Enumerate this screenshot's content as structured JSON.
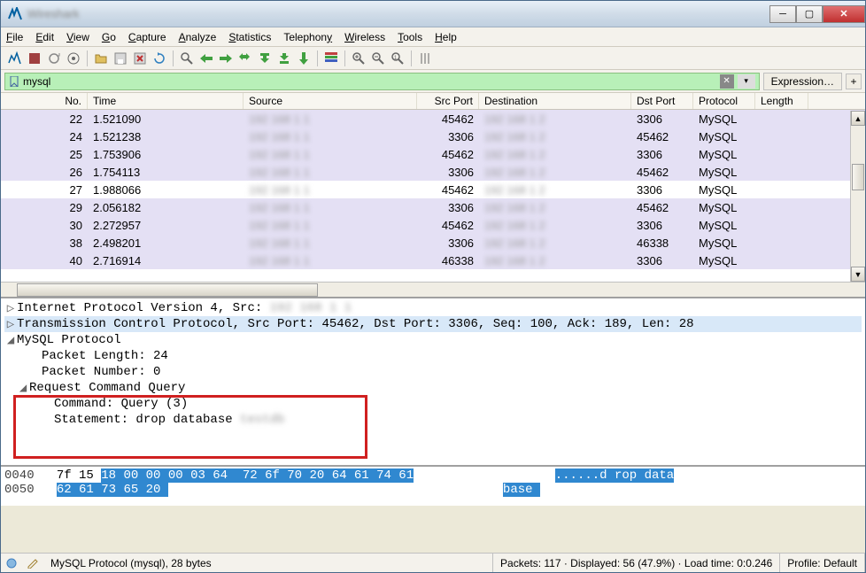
{
  "window": {
    "title": "Wireshark"
  },
  "menu": [
    "File",
    "Edit",
    "View",
    "Go",
    "Capture",
    "Analyze",
    "Statistics",
    "Telephony",
    "Wireless",
    "Tools",
    "Help"
  ],
  "filter": {
    "value": "mysql",
    "expression_label": "Expression…",
    "plus": "+"
  },
  "columns": {
    "no": "No.",
    "time": "Time",
    "src": "Source",
    "sport": "Src Port",
    "dst": "Destination",
    "dport": "Dst Port",
    "proto": "Protocol",
    "len": "Length"
  },
  "packets": [
    {
      "no": "22",
      "time": "1.521090",
      "sport": "45462",
      "dport": "3306",
      "proto": "MySQL"
    },
    {
      "no": "24",
      "time": "1.521238",
      "sport": "3306",
      "dport": "45462",
      "proto": "MySQL"
    },
    {
      "no": "25",
      "time": "1.753906",
      "sport": "45462",
      "dport": "3306",
      "proto": "MySQL"
    },
    {
      "no": "26",
      "time": "1.754113",
      "sport": "3306",
      "dport": "45462",
      "proto": "MySQL"
    },
    {
      "no": "27",
      "time": "1.988066",
      "sport": "45462",
      "dport": "3306",
      "proto": "MySQL",
      "selected": true
    },
    {
      "no": "29",
      "time": "2.056182",
      "sport": "3306",
      "dport": "45462",
      "proto": "MySQL"
    },
    {
      "no": "30",
      "time": "2.272957",
      "sport": "45462",
      "dport": "3306",
      "proto": "MySQL"
    },
    {
      "no": "38",
      "time": "2.498201",
      "sport": "3306",
      "dport": "46338",
      "proto": "MySQL"
    },
    {
      "no": "40",
      "time": "2.716914",
      "sport": "46338",
      "dport": "3306",
      "proto": "MySQL"
    }
  ],
  "details": {
    "ip_line": "Internet Protocol Version 4, Src: ",
    "tcp_line": "Transmission Control Protocol, Src Port: 45462, Dst Port: 3306, Seq: 100, Ack: 189, Len: 28",
    "mysql_header": "MySQL Protocol",
    "packet_length": "Packet Length: 24",
    "packet_number": "Packet Number: 0",
    "req_cmd": "Request Command Query",
    "command": "Command: Query (3)",
    "statement": "Statement: drop database "
  },
  "bytes": {
    "l1_off": "0040",
    "l1_a": "7f 15 ",
    "l1_b": "18 00 00 00 03 64  72 6f 70 20 64 61 74 61",
    "l1_ascii_a": "......d rop data",
    "l2_off": "0050",
    "l2_hex": "62 61 73 65 20 ",
    "l2_ascii": "base "
  },
  "status": {
    "field": "MySQL Protocol (mysql), 28 bytes",
    "packets": "Packets: 117 · Displayed: 56 (47.9%) · Load time: 0:0.246",
    "profile": "Profile: Default"
  }
}
